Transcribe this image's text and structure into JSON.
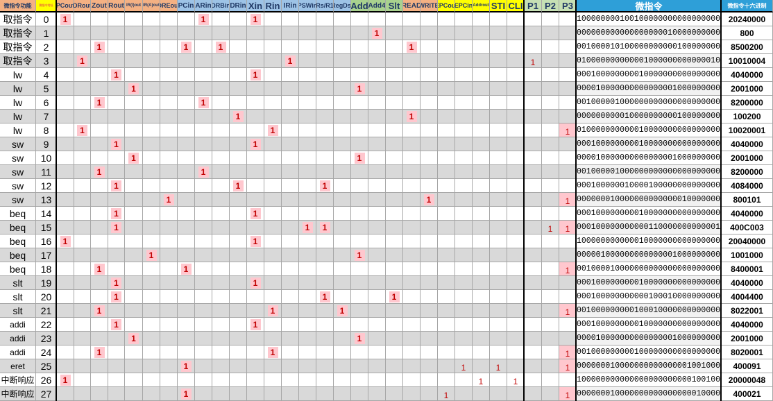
{
  "sheet_title": "",
  "headers": {
    "func": "微指令功能",
    "addr": "微指令地址",
    "signals": [
      "PCout",
      "DRout",
      "Zout",
      "Rout",
      "IR(I)out",
      "IR(A)out",
      "DREout",
      "PCin",
      "ARin",
      "DRBin",
      "DRin",
      "Xin",
      "Rin",
      "IRin",
      "PSWin",
      "Rs/R1",
      "RegDst",
      "Add",
      "Add4",
      "Slt",
      "READ",
      "WRITE",
      "EPCout",
      "EPCin",
      "Addrout",
      "STI",
      "CLI",
      "P1",
      "P2",
      "P3"
    ],
    "micro": "微指令",
    "hex": "微指令十六进制"
  },
  "header_colors": {
    "orange": "#f4b183",
    "blue": "#9dc3e6",
    "green": "#a9d18e",
    "yellow": "#ffff00",
    "cyan": "#2e9fd8",
    "p_green": "#c6e0b4"
  },
  "rows": [
    {
      "func": "取指令",
      "idx": "0",
      "ones": [
        0,
        8,
        11
      ],
      "p3": false,
      "bin": "1000000001001000000000000000000",
      "hex": "20240000"
    },
    {
      "func": "取指令",
      "idx": "1",
      "ones": [
        18
      ],
      "p3": false,
      "bin": "0000000000000000000100000000000",
      "hex": "800"
    },
    {
      "func": "取指令",
      "idx": "2",
      "ones": [
        2,
        7,
        9,
        20
      ],
      "p3": false,
      "bin": "0010000101000000000001000000000",
      "hex": "8500200"
    },
    {
      "func": "取指令",
      "idx": "3",
      "ones": [
        1,
        13,
        27
      ],
      "p3": false,
      "bin": "0100000000000010000000000000100",
      "hex": "10010004"
    },
    {
      "func": "lw",
      "idx": "4",
      "ones": [
        3,
        11
      ],
      "p3": false,
      "bin": "0001000000000100000000000000000",
      "hex": "4040000"
    },
    {
      "func": "lw",
      "idx": "5",
      "ones": [
        4,
        17
      ],
      "p3": false,
      "bin": "0000100000000000000010000000000",
      "hex": "2001000"
    },
    {
      "func": "lw",
      "idx": "6",
      "ones": [
        2,
        8
      ],
      "p3": false,
      "bin": "0010000010000000000000000000000",
      "hex": "8200000"
    },
    {
      "func": "lw",
      "idx": "7",
      "ones": [
        10,
        20
      ],
      "p3": false,
      "bin": "0000000000100000000001000000000",
      "hex": "100200"
    },
    {
      "func": "lw",
      "idx": "8",
      "ones": [
        1,
        12
      ],
      "p3": true,
      "bin": "0100000000000100000000000000001",
      "hex": "10020001"
    },
    {
      "func": "sw",
      "idx": "9",
      "ones": [
        3,
        11
      ],
      "p3": false,
      "bin": "0001000000000100000000000000000",
      "hex": "4040000"
    },
    {
      "func": "sw",
      "idx": "10",
      "ones": [
        4,
        17
      ],
      "p3": false,
      "bin": "0000100000000000000010000000000",
      "hex": "2001000"
    },
    {
      "func": "sw",
      "idx": "11",
      "ones": [
        2,
        8
      ],
      "p3": false,
      "bin": "0010000010000000000000000000000",
      "hex": "8200000"
    },
    {
      "func": "sw",
      "idx": "12",
      "ones": [
        3,
        10,
        15
      ],
      "p3": false,
      "bin": "0001000000100001000000000000000",
      "hex": "4084000"
    },
    {
      "func": "sw",
      "idx": "13",
      "ones": [
        6,
        21
      ],
      "p3": true,
      "bin": "0000000100000000000000100000001",
      "hex": "800101"
    },
    {
      "func": "beq",
      "idx": "14",
      "ones": [
        3,
        11
      ],
      "p3": false,
      "bin": "0001000000000100000000000000000",
      "hex": "4040000"
    },
    {
      "func": "beq",
      "idx": "15",
      "ones": [
        3,
        14,
        15,
        28
      ],
      "p3": true,
      "bin": "0001000000000001100000000000011",
      "hex": "400C003"
    },
    {
      "func": "beq",
      "idx": "16",
      "ones": [
        0,
        11
      ],
      "p3": false,
      "bin": "1000000000000100000000000000000",
      "hex": "20040000"
    },
    {
      "func": "beq",
      "idx": "17",
      "ones": [
        5,
        17
      ],
      "p3": false,
      "bin": "0000010000000000000010000000000",
      "hex": "1001000"
    },
    {
      "func": "beq",
      "idx": "18",
      "ones": [
        2,
        7
      ],
      "p3": true,
      "bin": "0010000100000000000000000000001",
      "hex": "8400001"
    },
    {
      "func": "slt",
      "idx": "19",
      "ones": [
        3,
        11
      ],
      "p3": false,
      "bin": "0001000000000100000000000000000",
      "hex": "4040000"
    },
    {
      "func": "slt",
      "idx": "20",
      "ones": [
        3,
        15,
        19
      ],
      "p3": false,
      "bin": "0001000000000001000100000000000",
      "hex": "4004400"
    },
    {
      "func": "slt",
      "idx": "21",
      "ones": [
        2,
        12,
        16
      ],
      "p3": true,
      "bin": "0010000000001000100000000000001",
      "hex": "8022001"
    },
    {
      "func": "addi",
      "idx": "22",
      "ones": [
        3,
        11
      ],
      "p3": false,
      "bin": "0001000000000100000000000000000",
      "hex": "4040000"
    },
    {
      "func": "addi",
      "idx": "23",
      "ones": [
        4,
        17
      ],
      "p3": false,
      "bin": "0000100000000000000010000000000",
      "hex": "2001000"
    },
    {
      "func": "addi",
      "idx": "24",
      "ones": [
        2,
        12
      ],
      "p3": true,
      "bin": "0010000000001000000000000000001",
      "hex": "8020001"
    },
    {
      "func": "eret",
      "idx": "25",
      "ones": [
        7,
        23,
        25
      ],
      "p3": true,
      "bin": "0000000100000000000000010010001",
      "hex": "400091"
    },
    {
      "func": "中断响应",
      "idx": "26",
      "ones": [
        0,
        24,
        26
      ],
      "p3": false,
      "bin": "1000000000000000000000001001000",
      "hex": "20000048"
    },
    {
      "func": "中断响应",
      "idx": "27",
      "ones": [
        7,
        22
      ],
      "p3": true,
      "bin": "0000000100000000000000000100001",
      "hex": "400021"
    }
  ],
  "one_label": "1"
}
